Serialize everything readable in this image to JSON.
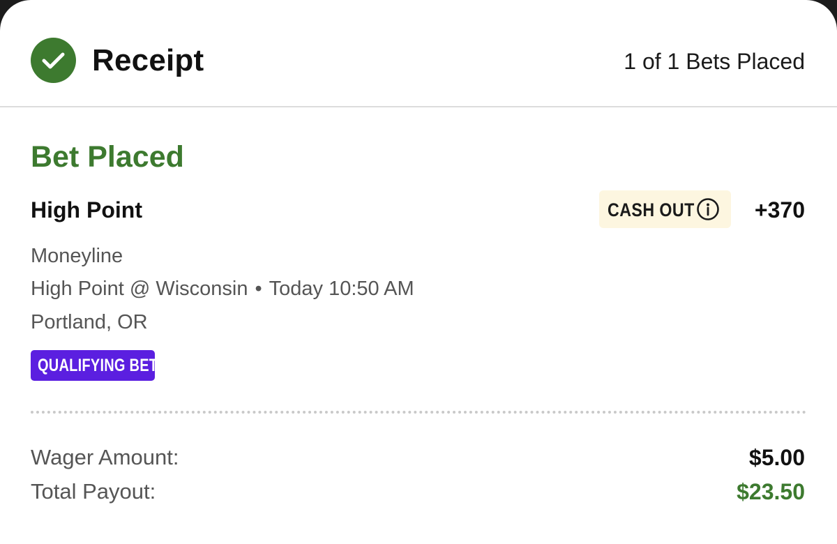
{
  "header": {
    "title": "Receipt",
    "bets_count": "1 of 1 Bets Placed",
    "status_icon": "check-icon"
  },
  "bet": {
    "status": "Bet Placed",
    "selection": "High Point",
    "cash_out_label": "CASH OUT",
    "cash_out_icon": "info-icon",
    "odds": "+370",
    "market": "Moneyline",
    "event_teams": "High Point @ Wisconsin",
    "event_separator": "•",
    "event_time": "Today 10:50 AM",
    "location": "Portland, OR",
    "promo_badge": "QUALIFYING BET"
  },
  "summary": {
    "wager_label": "Wager Amount:",
    "wager_value": "$5.00",
    "payout_label": "Total Payout:",
    "payout_value": "$23.50"
  },
  "colors": {
    "success_green": "#3d7a2f",
    "promo_purple": "#5b1fe0",
    "cashout_bg": "#fdf6e0"
  }
}
